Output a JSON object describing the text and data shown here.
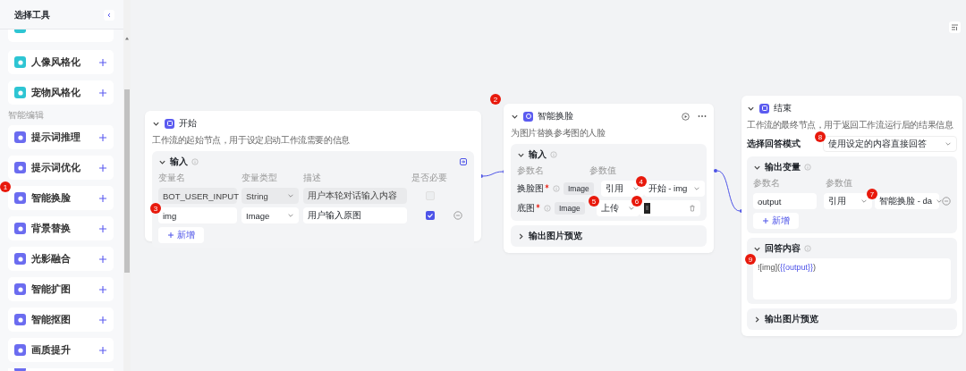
{
  "sidebar": {
    "title": "选择工具",
    "items": [
      {
        "kind": "cut",
        "color": "#2ec5d3"
      },
      {
        "kind": "tool",
        "label": "人像风格化",
        "color": "#2ec5d3"
      },
      {
        "kind": "tool",
        "label": "宠物风格化",
        "color": "#2ec5d3"
      },
      {
        "kind": "section",
        "label": "智能编辑"
      },
      {
        "kind": "tool",
        "label": "提示词推理",
        "color": "#6b6cf0"
      },
      {
        "kind": "tool",
        "label": "提示词优化",
        "color": "#6b6cf0"
      },
      {
        "kind": "tool",
        "label": "智能换脸",
        "color": "#6b6cf0",
        "badge": "1"
      },
      {
        "kind": "tool",
        "label": "背景替换",
        "color": "#6b6cf0"
      },
      {
        "kind": "tool",
        "label": "光影融合",
        "color": "#6b6cf0"
      },
      {
        "kind": "tool",
        "label": "智能扩图",
        "color": "#6b6cf0"
      },
      {
        "kind": "tool",
        "label": "智能抠图",
        "color": "#6b6cf0"
      },
      {
        "kind": "tool",
        "label": "画质提升",
        "color": "#6b6cf0"
      },
      {
        "kind": "cut",
        "color": "#6b6cf0"
      }
    ]
  },
  "start_node": {
    "title": "开始",
    "description": "工作流的起始节点，用于设定启动工作流需要的信息",
    "input": {
      "title": "输入",
      "columns": [
        "变量名",
        "变量类型",
        "描述",
        "是否必要"
      ],
      "rows": [
        {
          "name": "BOT_USER_INPUT",
          "type": "String",
          "description": "用户本轮对话输入内容",
          "required": false,
          "disabled": true
        },
        {
          "name": "img",
          "type": "Image",
          "description": "用户输入原图",
          "required": true,
          "disabled": false,
          "badge": "3"
        }
      ],
      "add_button": "新增"
    }
  },
  "face_swap_node": {
    "badge": "2",
    "title": "智能换脸",
    "description": "为图片替换参考图的人脸",
    "input": {
      "title": "输入",
      "columns": [
        "参数名",
        "参数值"
      ],
      "params": [
        {
          "name": "换脸图",
          "required": true,
          "type": "Image",
          "source": {
            "text": "引用"
          },
          "value": {
            "kind": "text",
            "text": "开始 - img",
            "badge": "4"
          }
        },
        {
          "name": "底图",
          "required": true,
          "type": "Image",
          "source": {
            "text": "上传",
            "badge": "5"
          },
          "value": {
            "kind": "upload",
            "badge": "6"
          }
        }
      ]
    },
    "output_preview": {
      "title": "输出图片预览",
      "expanded": false
    }
  },
  "end_node": {
    "title": "结束",
    "description": "工作流的最终节点，用于返回工作流运行后的结果信息",
    "answer_mode": {
      "label": "选择回答模式",
      "value": "使用设定的内容直接回答",
      "badge": "8"
    },
    "output": {
      "title": "输出变量",
      "columns": [
        "参数名",
        "参数值"
      ],
      "rows": [
        {
          "name": "output",
          "source": "引用",
          "value": "智能换脸 - da",
          "badge": "7"
        }
      ],
      "add_button": "新增"
    },
    "answer": {
      "title": "回答内容",
      "badge": "9",
      "content": [
        {
          "kind": "plain",
          "text": "![img]("
        },
        {
          "kind": "variable",
          "text": "{{output}}"
        },
        {
          "kind": "plain",
          "text": ")"
        }
      ]
    },
    "output_preview": {
      "title": "输出图片预览",
      "expanded": false
    }
  }
}
